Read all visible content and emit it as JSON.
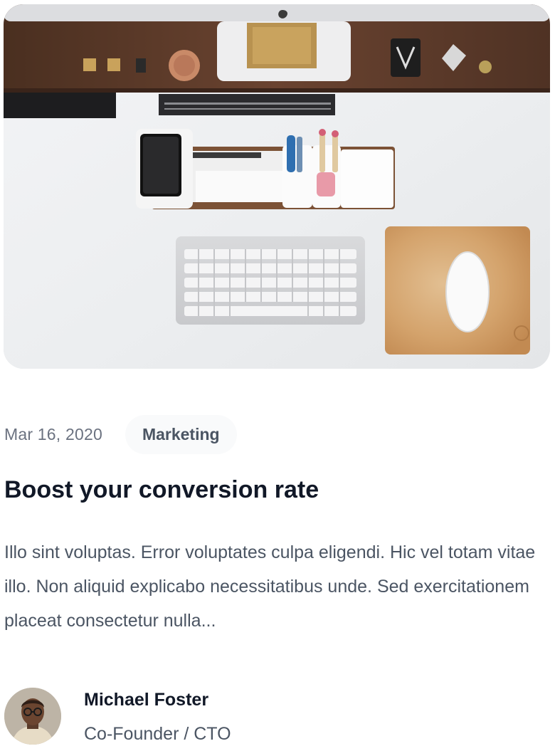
{
  "post": {
    "image_alt": "Top-down view of a white desk with a wooden shelf, keyboard, mouse on a leather pad, phone dock and pen holders",
    "date": "Mar 16, 2020",
    "category": "Marketing",
    "title": "Boost your conversion rate",
    "excerpt": "Illo sint voluptas. Error voluptates culpa eligendi. Hic vel totam vitae illo. Non aliquid explicabo necessitatibus unde. Sed exercitationem placeat consectetur nulla..."
  },
  "author": {
    "name": "Michael Foster",
    "role": "Co-Founder / CTO"
  },
  "colors": {
    "text_primary": "#111827",
    "text_secondary": "#4b5563",
    "text_muted": "#6b7280",
    "badge_bg": "#f9fafb"
  }
}
